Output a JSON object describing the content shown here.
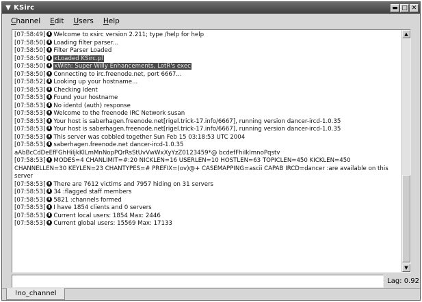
{
  "window": {
    "title": "KSirc",
    "buttons": {
      "minimize": "▬",
      "maximize": "□",
      "close": "✕"
    }
  },
  "menu": [
    "Channel",
    "Edit",
    "Users",
    "Help"
  ],
  "log": [
    {
      "ts": "[07:58:49]",
      "text": "Welcome to ᴋsirc version 2.211; type /help for help"
    },
    {
      "ts": "[07:58:50]",
      "text": "Loading filter parser..."
    },
    {
      "ts": "[07:58:50]",
      "text": "Filter Parser Loaded"
    },
    {
      "ts": "[07:58:50]",
      "text": "ᴋLoaded KSirc.pl",
      "highlight": true
    },
    {
      "ts": "[07:58:50]",
      "text": "ᴋWith: Super Willy Enhancements, LotR's exec",
      "highlight": true
    },
    {
      "ts": "[07:58:50]",
      "text": "Connecting to irc.freenode.net, port 6667..."
    },
    {
      "ts": "[07:58:52]",
      "text": "Looking up your hostname..."
    },
    {
      "ts": "[07:58:53]",
      "text": "Checking Ident"
    },
    {
      "ts": "[07:58:53]",
      "text": "Found your hostname"
    },
    {
      "ts": "[07:58:53]",
      "text": "No identd (auth) response"
    },
    {
      "ts": "[07:58:53]",
      "text": "Welcome to the freenode IRC Network susan"
    },
    {
      "ts": "[07:58:53]",
      "text": "Your host is saberhagen.freenode.net[rigel.trick-17.info/6667], running version dancer-ircd-1.0.35"
    },
    {
      "ts": "[07:58:53]",
      "text": "Your host is saberhagen.freenode.net[rigel.trick-17.info/6667], running version dancer-ircd-1.0.35"
    },
    {
      "ts": "[07:58:53]",
      "text": "This server was cobbled together Sun Feb 15 03:18:53 UTC 2004"
    },
    {
      "ts": "[07:58:53]",
      "text": "saberhagen.freenode.net dancer-ircd-1.0.35"
    },
    {
      "ts": "",
      "text": "aAbBcCdDeEfFGhHiIjkKlLmMnNopPQrRsStUvVwWxXyYzZ0123459*@ bcdefFhiIklmnoPqstv",
      "nodot": true
    },
    {
      "ts": "[07:58:53]",
      "text": "MODES=4 CHANLIMIT=#:20 NICKLEN=16 USERLEN=10 HOSTLEN=63 TOPICLEN=450 KICKLEN=450 CHANNELLEN=30 KEYLEN=23 CHANTYPES=# PREFIX=(ov)@+ CASEMAPPING=ascii CAPAB IRCD=dancer :are available on this server",
      "wrap": true
    },
    {
      "ts": "[07:58:53]",
      "text": "There are 7612 victims and 7957 hiding on 31 servers"
    },
    {
      "ts": "[07:58:53]",
      "text": "34 :flagged staff members"
    },
    {
      "ts": "[07:58:53]",
      "text": "5821 :channels formed"
    },
    {
      "ts": "[07:58:53]",
      "text": "I have 1854 clients and 0 servers"
    },
    {
      "ts": "[07:58:53]",
      "text": "Current local  users: 1854  Max: 2446"
    },
    {
      "ts": "[07:58:53]",
      "text": "Current global users: 15569  Max: 17133"
    }
  ],
  "scrollbar": {
    "up_arrow": "▲",
    "down_arrow": "▼"
  },
  "input": {
    "value": ""
  },
  "status": {
    "lag": "Lag: 0.92"
  },
  "tabs": [
    {
      "label": "!no_channel",
      "active": true
    }
  ],
  "icons": {
    "app": "ksirc-logo-icon",
    "message_marker": "info-dot-icon"
  }
}
